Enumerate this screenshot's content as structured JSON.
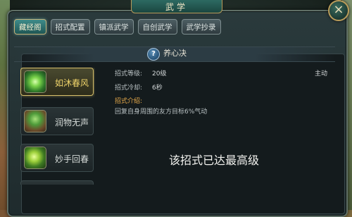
{
  "window": {
    "title": "武学",
    "close_glyph": "×"
  },
  "tabs": [
    {
      "label": "藏经阁",
      "active": true
    },
    {
      "label": "招式配置",
      "active": false
    },
    {
      "label": "镇派武学",
      "active": false
    },
    {
      "label": "自创武学",
      "active": false
    },
    {
      "label": "武学抄录",
      "active": false
    }
  ],
  "skill_header": {
    "help_glyph": "?",
    "name": "养心决"
  },
  "skills": [
    {
      "name": "如沐春风",
      "selected": true,
      "icon": "green-orb-icon"
    },
    {
      "name": "润物无声",
      "selected": false,
      "icon": "sprout-icon"
    },
    {
      "name": "妙手回春",
      "selected": false,
      "icon": "vine-icon"
    }
  ],
  "details": {
    "level_label": "招式等级:",
    "level_value": "20级",
    "type_value": "主动",
    "cooldown_label": "招式冷却:",
    "cooldown_value": "6秒",
    "intro_heading": "招式介绍:",
    "intro_text": "回复自身周围的友方目标6%气动"
  },
  "status_message": "该招式已达最高级",
  "colors": {
    "accent_gold": "#d6bf6a",
    "tab_active": "#3f8c8a",
    "heading_orange": "#e6a94a"
  }
}
